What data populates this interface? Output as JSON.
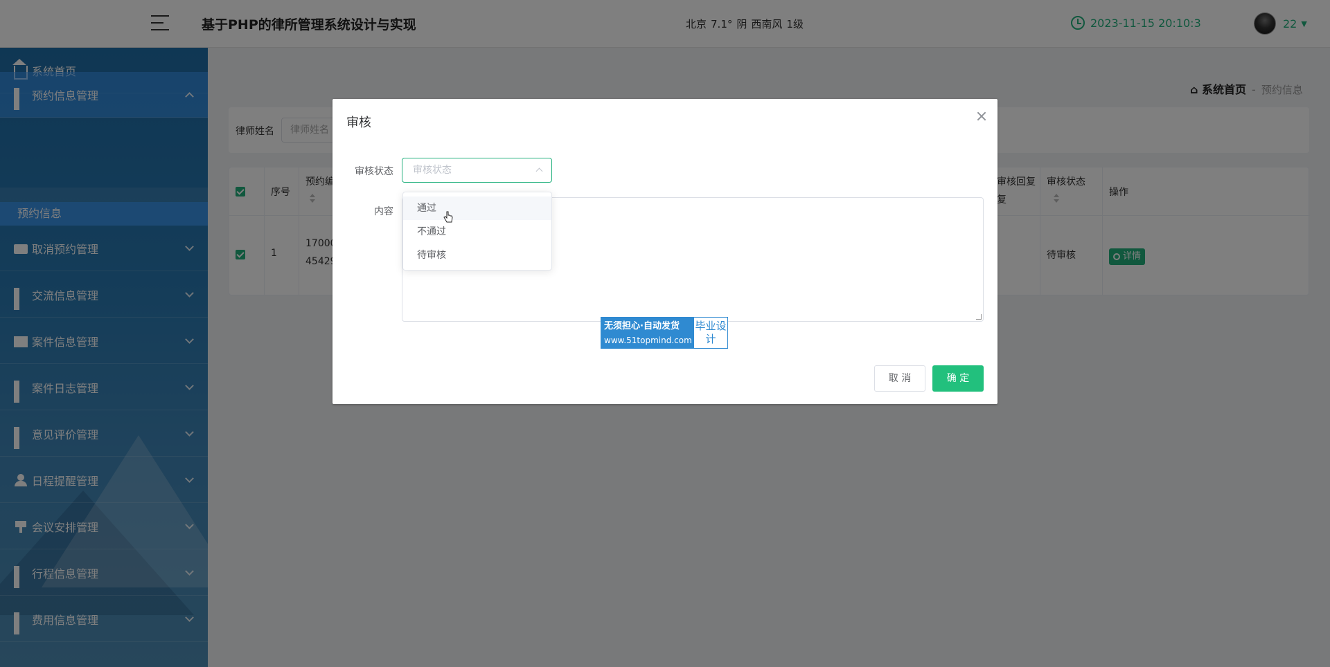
{
  "header": {
    "title": "基于PHP的律所管理系统设计与实现",
    "weather": {
      "city": "北京",
      "temp": "7.1°",
      "condition": "阴",
      "wind": "西南风",
      "level": "1级"
    },
    "datetime": "2023-11-15 20:10:3",
    "user": "22"
  },
  "sidebar": {
    "items": [
      {
        "label": "系统首页",
        "icon": "home-icon"
      },
      {
        "label": "预约信息管理",
        "icon": "grid-icon"
      },
      {
        "label": "取消预约管理",
        "icon": "ticket-icon"
      },
      {
        "label": "交流信息管理",
        "icon": "grid-icon"
      },
      {
        "label": "案件信息管理",
        "icon": "chart-icon"
      },
      {
        "label": "案件日志管理",
        "icon": "grid-icon"
      },
      {
        "label": "意见评价管理",
        "icon": "grid-icon"
      },
      {
        "label": "日程提醒管理",
        "icon": "user-icon"
      },
      {
        "label": "会议安排管理",
        "icon": "pin-icon"
      },
      {
        "label": "行程信息管理",
        "icon": "grid-icon"
      },
      {
        "label": "费用信息管理",
        "icon": "grid-icon"
      }
    ],
    "active_sub": "预约信息"
  },
  "breadcrumb": {
    "home": "系统首页",
    "sep": "-",
    "current": "预约信息"
  },
  "search": {
    "label": "律师姓名",
    "placeholder": "律师姓名"
  },
  "table": {
    "headers": {
      "index": "序号",
      "booking_no": "预约编",
      "reply": "审核回复",
      "reply_2": "复",
      "status": "审核状态",
      "action": "操作"
    },
    "row": {
      "index": "1",
      "booking_no_1": "17000",
      "booking_no_2": "45429",
      "status": "待审核",
      "action": "详情"
    }
  },
  "dialog": {
    "title": "审核",
    "status_label": "审核状态",
    "status_placeholder": "审核状态",
    "content_label": "内容",
    "options": [
      "通过",
      "不通过",
      "待审核"
    ],
    "cancel": "取 消",
    "confirm": "确 定"
  },
  "watermark": {
    "line1": "无须担心·自动发货",
    "line2": "www.51topmind.com",
    "right": "毕业设计"
  },
  "colors": {
    "accent": "#22b07d",
    "sidebar": "#2a7ab3"
  }
}
